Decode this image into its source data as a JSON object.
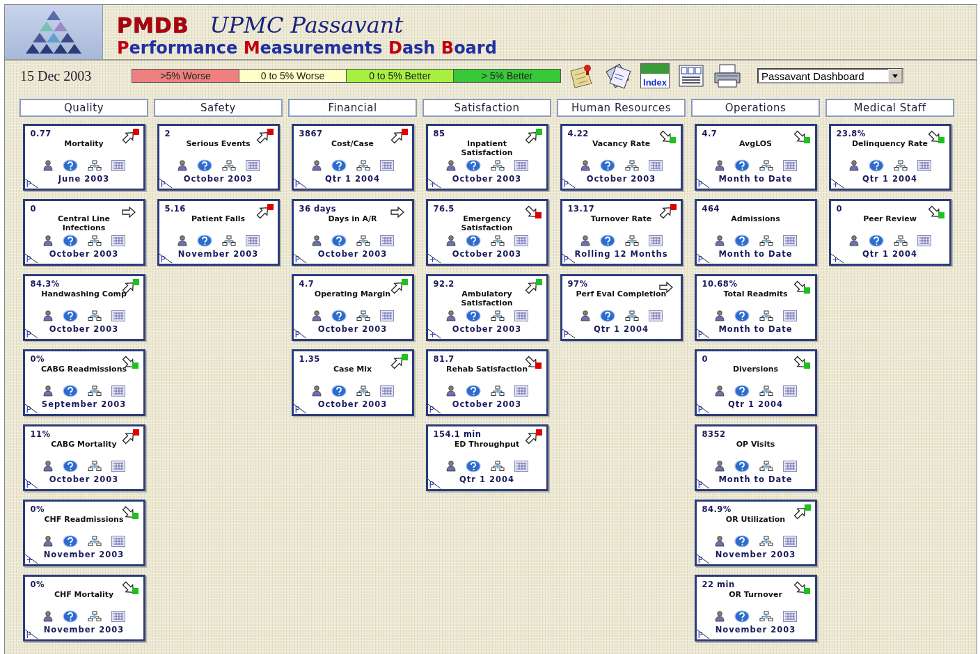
{
  "header": {
    "brand": "PMDB",
    "site": "UPMC Passavant",
    "subtitle_words": [
      "Performance",
      "Measurements",
      "Dash",
      "Board"
    ]
  },
  "toolbar": {
    "date": "15 Dec 2003",
    "legend": [
      {
        "label": ">5% Worse",
        "color": "#f08080"
      },
      {
        "label": "0 to 5% Worse",
        "color": "#ffffc8"
      },
      {
        "label": "0 to 5% Better",
        "color": "#a8f040"
      },
      {
        "label": "> 5% Better",
        "color": "#38c838"
      }
    ],
    "index_label": "Index",
    "dashboard_select": "Passavant Dashboard"
  },
  "columns": [
    {
      "title": "Quality",
      "cards": [
        {
          "value": "0.77",
          "title": "Mortality",
          "kind": "up",
          "color": "#e00000",
          "corner": "P",
          "period": "June 2003"
        },
        {
          "value": "0",
          "title": "Central Line Infections",
          "kind": "flat",
          "corner": "P",
          "period": "October 2003"
        },
        {
          "value": "84.3%",
          "title": "Handwashing Comp",
          "kind": "up",
          "color": "#20c020",
          "corner": "P",
          "period": "October 2003"
        },
        {
          "value": "0%",
          "title": "CABG Readmissions",
          "kind": "down",
          "color": "#20c020",
          "corner": "P",
          "period": "September 2003"
        },
        {
          "value": "11%",
          "title": "CABG Mortality",
          "kind": "up",
          "color": "#e00000",
          "corner": "P",
          "period": "October 2003"
        },
        {
          "value": "0%",
          "title": "CHF Readmissions",
          "kind": "down",
          "color": "#20c020",
          "corner": "+",
          "period": "November 2003"
        },
        {
          "value": "0%",
          "title": "CHF Mortality",
          "kind": "down",
          "color": "#20c020",
          "corner": "P",
          "period": "November 2003"
        }
      ]
    },
    {
      "title": "Safety",
      "cards": [
        {
          "value": "2",
          "title": "Serious Events",
          "kind": "up",
          "color": "#e00000",
          "corner": "P",
          "period": "October 2003"
        },
        {
          "value": "5.16",
          "title": "Patient Falls",
          "kind": "up",
          "color": "#e00000",
          "corner": "P",
          "period": "November 2003"
        }
      ]
    },
    {
      "title": "Financial",
      "cards": [
        {
          "value": "3867",
          "title": "Cost/Case",
          "kind": "up",
          "color": "#e00000",
          "corner": "P",
          "period": "Qtr 1 2004"
        },
        {
          "value": "36 days",
          "title": "Days in A/R",
          "kind": "flat",
          "corner": "P",
          "period": "October 2003"
        },
        {
          "value": "4.7",
          "title": "Operating Margin",
          "kind": "up",
          "color": "#20c020",
          "corner": "P",
          "period": "October 2003"
        },
        {
          "value": "1.35",
          "title": "Case Mix",
          "kind": "up",
          "color": "#20c020",
          "corner": "P",
          "period": "October 2003"
        }
      ]
    },
    {
      "title": "Satisfaction",
      "cards": [
        {
          "value": "85",
          "title": "Inpatient Satisfaction",
          "kind": "up",
          "color": "#20c020",
          "corner": "+",
          "period": "October 2003"
        },
        {
          "value": "76.5",
          "title": "Emergency Satisfaction",
          "kind": "down",
          "color": "#e00000",
          "corner": "+",
          "period": "October 2003"
        },
        {
          "value": "92.2",
          "title": "Ambulatory Satisfaction",
          "kind": "up",
          "color": "#20c020",
          "corner": "+",
          "period": "October 2003"
        },
        {
          "value": "81.7",
          "title": "Rehab Satisfaction",
          "kind": "down",
          "color": "#e00000",
          "corner": "P",
          "period": "October 2003"
        },
        {
          "value": "154.1 min",
          "title": "ED Throughput",
          "kind": "up",
          "color": "#e00000",
          "corner": "P",
          "period": "Qtr 1 2004"
        }
      ]
    },
    {
      "title": "Human Resources",
      "cards": [
        {
          "value": "4.22",
          "title": "Vacancy Rate",
          "kind": "down",
          "color": "#20c020",
          "corner": "P",
          "period": "October 2003"
        },
        {
          "value": "13.17",
          "title": "Turnover Rate",
          "kind": "up",
          "color": "#e00000",
          "corner": "P",
          "period": "Rolling 12 Months"
        },
        {
          "value": "97%",
          "title": "Perf Eval Completion",
          "kind": "flat",
          "corner": "P",
          "period": "Qtr 1 2004"
        }
      ]
    },
    {
      "title": "Operations",
      "cards": [
        {
          "value": "4.7",
          "title": "AvgLOS",
          "kind": "down",
          "color": "#20c020",
          "corner": "P",
          "period": "Month to Date"
        },
        {
          "value": "464",
          "title": "Admissions",
          "kind": "plain",
          "corner": "P",
          "period": "Month to Date"
        },
        {
          "value": "10.68%",
          "title": "Total Readmits",
          "kind": "down",
          "color": "#20c020",
          "corner": "P",
          "period": "Month to Date"
        },
        {
          "value": "0",
          "title": "Diversions",
          "kind": "down",
          "color": "#20c020",
          "corner": "P",
          "period": "Qtr 1 2004"
        },
        {
          "value": "8352",
          "title": "OP Visits",
          "kind": "plain",
          "corner": "P",
          "period": "Month to Date"
        },
        {
          "value": "84.9%",
          "title": "OR Utilization",
          "kind": "up",
          "color": "#20c020",
          "corner": "P",
          "period": "November 2003"
        },
        {
          "value": "22 min",
          "title": "OR Turnover",
          "kind": "down",
          "color": "#20c020",
          "corner": "P",
          "period": "November 2003"
        }
      ]
    },
    {
      "title": "Medical Staff",
      "cards": [
        {
          "value": "23.8%",
          "title": "Delinquency Rate",
          "kind": "down",
          "color": "#20c020",
          "corner": "+",
          "period": "Qtr 1 2004"
        },
        {
          "value": "0",
          "title": "Peer Review",
          "kind": "down",
          "color": "#20c020",
          "corner": "+",
          "period": "Qtr 1 2004"
        }
      ]
    }
  ]
}
